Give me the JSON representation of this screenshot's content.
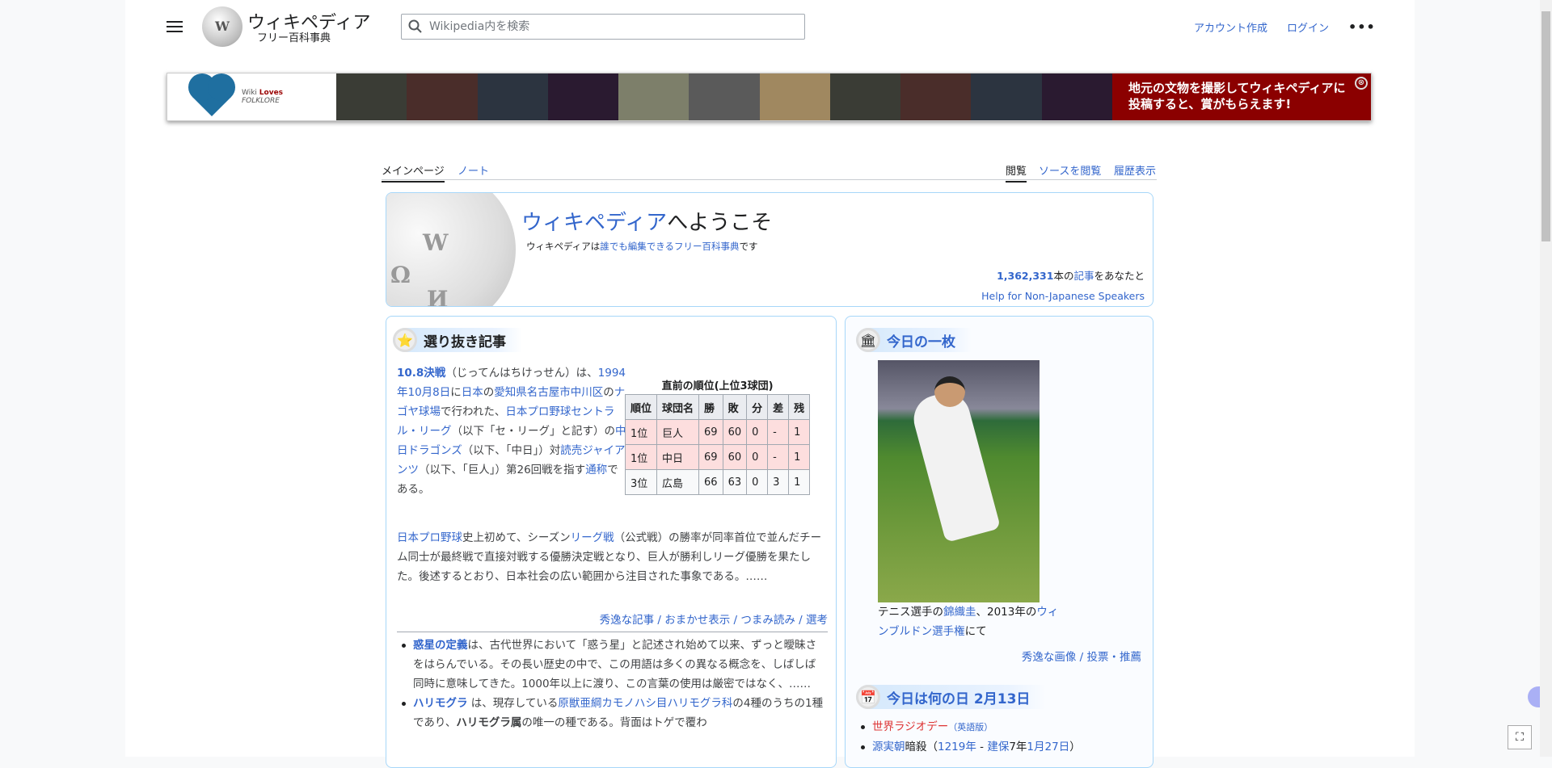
{
  "header": {
    "wordmark": "ウィキペディア",
    "tagline": "フリー百科事典",
    "search_placeholder": "Wikipedia内を検索",
    "create_account": "アカウント作成",
    "login": "ログイン",
    "more": "•••"
  },
  "banner": {
    "logo_word1": "Wiki",
    "logo_word2": "Loves",
    "logo_word3": "FOLKLORE",
    "message": "地元の文物を撮影してウィキペディアに投稿すると、賞がもらえます!",
    "close": "⊗"
  },
  "tabs": {
    "main": "メインページ",
    "talk": "ノート",
    "read": "閲覧",
    "view_source": "ソースを閲覧",
    "history": "履歴表示"
  },
  "welcome": {
    "title_link": "ウィキペディア",
    "title_rest": "へようこそ",
    "sub1": "ウィキペディアは",
    "sub_link1": "誰でも",
    "sub_link2": "編集",
    "sub2": "できる",
    "sub_link3": "フリー百科事典",
    "sub3": "です",
    "count": "1,362,331",
    "count_rest1": "本の",
    "count_link": "記事",
    "count_rest2": "をあなたと",
    "help": "Help for Non-Japanese Speakers"
  },
  "featured": {
    "title": "選り抜き記事",
    "p1_bold": "10.8決戦",
    "p1_a": "（じってんはちけっせん）は、",
    "p1_l1": "1994年",
    "p1_l2": "10月8日",
    "p1_b": "に",
    "p1_l3": "日本",
    "p1_c": "の",
    "p1_l4": "愛知県",
    "p1_l5": "名古屋市",
    "p1_l6": "中川区",
    "p1_d": "の",
    "p1_l7": "ナゴヤ球場",
    "p1_e": "で行われた、",
    "p1_l8": "日本プロ野球セントラル・リーグ",
    "p1_f": "（以下「セ・リーグ」と記す）の",
    "p1_l9": "中日ドラゴンズ",
    "p1_g": "（以下、「中日」）対",
    "p1_l10": "読売ジャイアンツ",
    "p1_h": "（以下、「巨人」）第26回戦を指す",
    "p1_l11": "通称",
    "p1_i": "である。",
    "p2_l1": "日本プロ野球",
    "p2_a": "史上初めて、シーズン",
    "p2_l2": "リーグ戦",
    "p2_b": "（公式戦）の勝率が同率首位で並んだチーム同士が最終戦で直接対戦する優勝決定戦となり、巨人が勝利しリーグ優勝を果たした。後述するとおり、日本社会の広い範囲から注目された事象である。……",
    "table": {
      "caption": "直前の順位(上位3球団)",
      "headers": [
        "順位",
        "球団名",
        "勝",
        "敗",
        "分",
        "差",
        "残"
      ],
      "rows": [
        [
          "1位",
          "巨人",
          "69",
          "60",
          "0",
          "-",
          "1"
        ],
        [
          "1位",
          "中日",
          "69",
          "60",
          "0",
          "-",
          "1"
        ],
        [
          "3位",
          "広島",
          "66",
          "63",
          "0",
          "3",
          "1"
        ]
      ]
    },
    "links": [
      "秀逸な記事",
      "おまかせ表示",
      "つまみ読み",
      "選考"
    ],
    "items": [
      {
        "bold": "惑星の定義",
        "text": "は、古代世界において「惑う星」と記述され始めて以来、ずっと曖昧さをはらんでいる。その長い歴史の中で、この用語は多くの異なる概念を、しばしば同時に意味してきた。1000年以上に渡り、この言葉の使用は厳密ではなく、……"
      },
      {
        "bold": "ハリモグラ",
        "text": " は、現存している",
        "link": "原獣亜綱カモノハシ目ハリモグラ科",
        "text2": "の4種のうちの1種であり、",
        "bold2": "ハリモグラ属",
        "text3": "の唯一の種である。背面はトゲで覆わ"
      }
    ]
  },
  "picture": {
    "title": "今日の一枚",
    "cap_a": "テニス選手の",
    "cap_l1": "錦織圭",
    "cap_b": "、2013年の",
    "cap_l2": "ウィンブルドン選手権",
    "cap_c": "にて",
    "links": [
      "秀逸な画像",
      "投票・推薦"
    ]
  },
  "today": {
    "title": "今日は何の日 2月13日",
    "items": [
      {
        "link": "世界ラジオデー",
        "note": "（英語版）"
      },
      {
        "link": "源実朝",
        "text": "暗殺（",
        "l2": "1219年",
        "t2": " - ",
        "l3": "建保",
        "t3": "7年",
        "l4": "1月27日",
        "t4": "）"
      }
    ]
  }
}
